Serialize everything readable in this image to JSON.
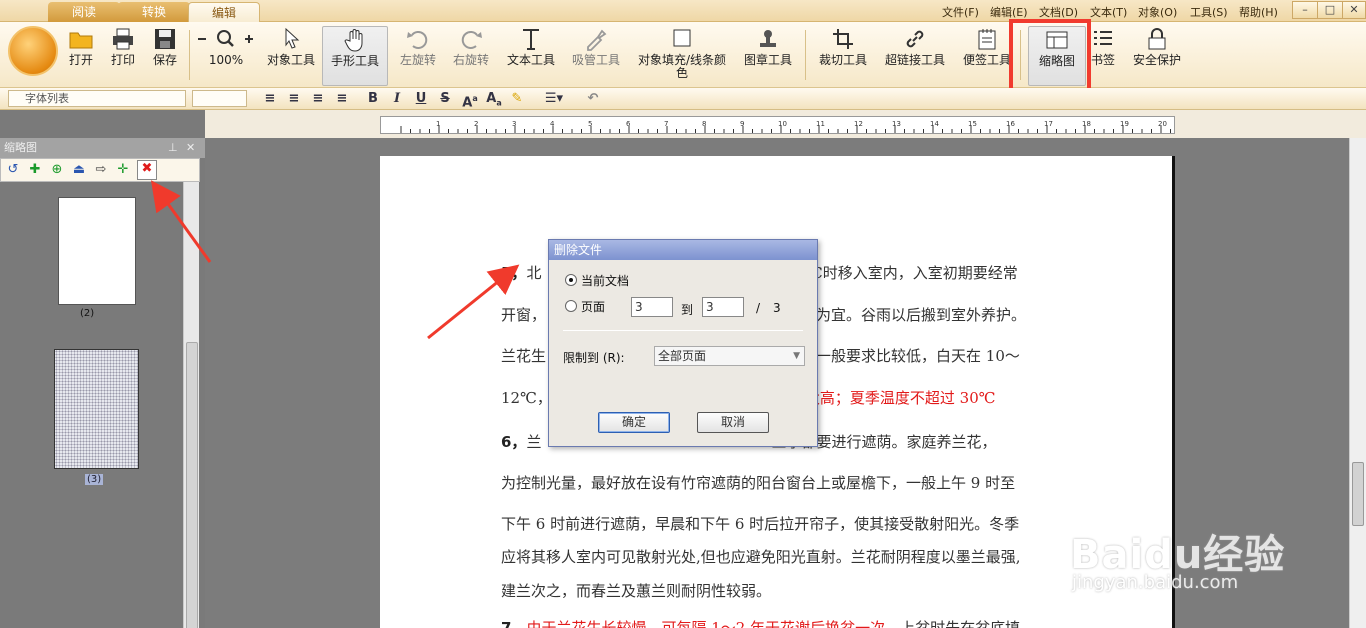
{
  "tabs": [
    {
      "label": "阅读",
      "active": false
    },
    {
      "label": "转换",
      "active": false
    },
    {
      "label": "编辑",
      "active": true
    }
  ],
  "menu": [
    "文件(F)",
    "编辑(E)",
    "文档(D)",
    "文本(T)",
    "对象(O)",
    "工具(S)",
    "帮助(H)"
  ],
  "toolbar": {
    "open": "打开",
    "print": "打印",
    "save": "保存",
    "zoom": "100%",
    "object_tool": "对象工具",
    "hand_tool": "手形工具",
    "rotate_left": "左旋转",
    "rotate_right": "右旋转",
    "text_tool": "文本工具",
    "eyedropper": "吸管工具",
    "fill_color": "对象填充/线条颜色",
    "stamp_tool": "图章工具",
    "crop_tool": "裁切工具",
    "hyperlink_tool": "超链接工具",
    "sticky_tool": "便签工具",
    "thumbnail": "缩略图",
    "bookmark": "书签",
    "security": "安全保护"
  },
  "format": {
    "font_list": "字体列表"
  },
  "ruler": {
    "marks": [
      "1",
      "2",
      "3",
      "4",
      "5",
      "6",
      "7",
      "8",
      "9",
      "10",
      "11",
      "12",
      "13",
      "14",
      "15",
      "16",
      "17",
      "18",
      "19",
      "20"
    ]
  },
  "left_panel": {
    "title": "缩略图",
    "thumb_labels": [
      "(2)",
      "(3)"
    ]
  },
  "document": {
    "lines": [
      {
        "num": "5，",
        "pre": "北",
        "text": "5℃时移入室内，入室初期要经常",
        "red": ""
      },
      {
        "num": "",
        "pre": "开窗，",
        "text": "右为宜。谷雨以后搬到室外养护。",
        "red": ""
      },
      {
        "num": "",
        "pre": "兰花生",
        "text": "度一般要求比较低，白天在 10～",
        "red": ""
      },
      {
        "num": "",
        "pre": "12℃，",
        "text": "",
        "red": "太高；夏季温度不超过 30℃"
      },
      {
        "num": "6，",
        "pre": "兰",
        "text": "三季都要进行遮荫。家庭养兰花，",
        "red": ""
      },
      {
        "num": "",
        "pre": "",
        "text": "为控制光量，最好放在设有竹帘遮荫的阳台窗台上或屋檐下，一般上午 9 时至",
        "red": ""
      },
      {
        "num": "",
        "pre": "",
        "text": "下午 6 时前进行遮荫，早晨和下午 6 时后拉开帘子，使其接受散射阳光。冬季",
        "red": ""
      },
      {
        "num": "",
        "pre": "",
        "text": "应将其移人室内可见散射光处,但也应避免阳光直射。兰花耐阴程度以墨兰最强,",
        "red": ""
      },
      {
        "num": "",
        "pre": "",
        "text": "建兰次之，而春兰及蕙兰则耐阴性较弱。",
        "red": ""
      },
      {
        "num": "7，",
        "pre": "",
        "text": "上盆时先在盆底填",
        "red": "由于兰花生长较慢，可每隔 1～2 年于花谢后换盆一次。"
      }
    ]
  },
  "dialog": {
    "title": "删除文件",
    "current_doc": "当前文档",
    "pages": "页面",
    "from": "3",
    "to_label": "到",
    "to": "3",
    "slash": "/",
    "total": "3",
    "limit_label": "限制到 (R):",
    "limit_value": "全部页面",
    "ok": "确定",
    "cancel": "取消"
  },
  "watermark": {
    "brand": "Baidu经验",
    "url": "jingyan.baidu.com"
  },
  "colors": {
    "accent": "#f13b2e",
    "title_bar": "#7d92d0"
  }
}
